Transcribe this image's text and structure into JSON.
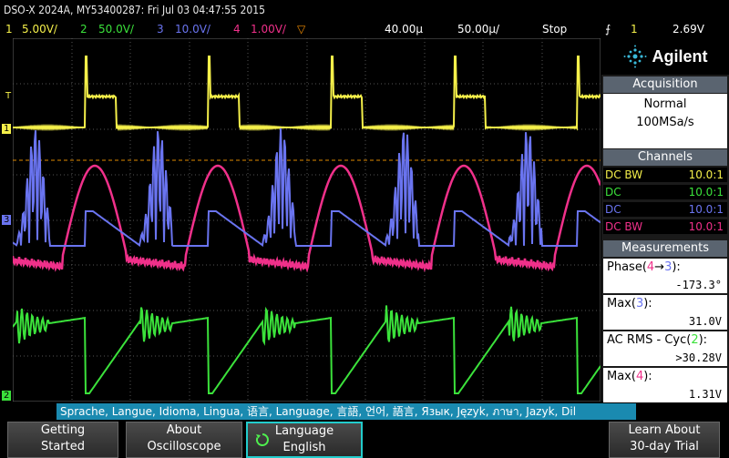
{
  "title": "DSO-X 2024A, MY53400287: Fri Jul 03 04:47:55 2015",
  "status": {
    "ch1": {
      "num": "1",
      "scale": "5.00V/",
      "color": "#f5f04a"
    },
    "ch2": {
      "num": "2",
      "scale": "50.0V/",
      "color": "#3be23b"
    },
    "ch3": {
      "num": "3",
      "scale": "10.0V/",
      "color": "#6a74f0"
    },
    "ch4": {
      "num": "4",
      "scale": "1.00V/",
      "color": "#f0308a"
    },
    "time_pos": "40.00µ",
    "time_div": "50.00µ/",
    "run_state": "Stop",
    "trig_src": "1",
    "trig_level": "2.69V"
  },
  "brand": {
    "name": "Agilent"
  },
  "acquisition": {
    "header": "Acquisition",
    "mode": "Normal",
    "rate": "100MSa/s"
  },
  "channels": {
    "header": "Channels",
    "rows": [
      {
        "coupling": "DC BW",
        "probe": "10.0:1",
        "color": "#f5f04a"
      },
      {
        "coupling": "DC",
        "probe": "10.0:1",
        "color": "#3be23b"
      },
      {
        "coupling": "DC",
        "probe": "10.0:1",
        "color": "#6a74f0"
      },
      {
        "coupling": "DC BW",
        "probe": "10.0:1",
        "color": "#f0308a"
      }
    ]
  },
  "measurements": {
    "header": "Measurements",
    "items": [
      {
        "label_pre": "Phase(",
        "label_a": "4",
        "arrow": "→",
        "label_b": "3",
        "label_post": "):",
        "value": "-173.3°",
        "ca": "#f0308a",
        "cb": "#6a74f0"
      },
      {
        "label_pre": "Max(",
        "label_a": "3",
        "label_post": "):",
        "value": "31.0V",
        "ca": "#6a74f0"
      },
      {
        "label_pre": "AC RMS - Cyc(",
        "label_a": "2",
        "label_post": "):",
        "value": ">30.28V",
        "ca": "#3be23b"
      },
      {
        "label_pre": "Max(",
        "label_a": "4",
        "label_post": "):",
        "value": "1.31V",
        "ca": "#f0308a"
      }
    ]
  },
  "markers": {
    "trigger": "T",
    "ch1": "1",
    "ch3": "3",
    "ch2": "2"
  },
  "language_strip": "Sprache, Langue, Idioma, Lingua, 语言, Language, 言語, 언어, 語言, Язык, Język, ภาษา, Jazyk, Dil",
  "softkeys": [
    {
      "l1": "Getting",
      "l2": "Started"
    },
    {
      "l1": "About",
      "l2": "Oscilloscope"
    },
    {
      "l1": "Language",
      "l2": "English"
    },
    {
      "l1": "Learn About",
      "l2": "30-day Trial"
    }
  ]
}
